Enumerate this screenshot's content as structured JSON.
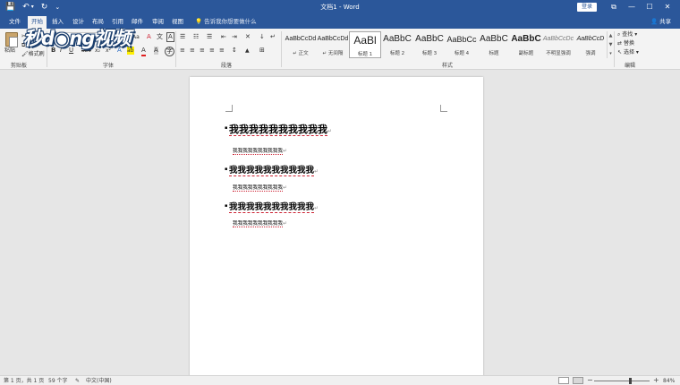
{
  "window": {
    "title": "文档1 - Word",
    "login": "登录",
    "qat": {
      "save": "💾",
      "undo": "↶",
      "undo_arrow": "▾",
      "redo": "↻",
      "customize": "⌄"
    },
    "controls": {
      "restore": "⧉",
      "minimize": "—",
      "maximize": "☐",
      "close": "✕"
    }
  },
  "tabs": [
    {
      "label": "文件",
      "active": false
    },
    {
      "label": "开始",
      "active": true
    },
    {
      "label": "插入",
      "active": false
    },
    {
      "label": "设计",
      "active": false
    },
    {
      "label": "布局",
      "active": false
    },
    {
      "label": "引用",
      "active": false
    },
    {
      "label": "邮件",
      "active": false
    },
    {
      "label": "审阅",
      "active": false
    },
    {
      "label": "视图",
      "active": false
    }
  ],
  "tell_me": "告诉我你想要做什么",
  "share": "共享",
  "share_icon": "person-icon",
  "ribbon": {
    "clipboard": {
      "paste": "粘贴",
      "format_painter": "格式刷",
      "label": "剪贴板"
    },
    "font": {
      "label": "字体",
      "font_size_grow": "A",
      "font_size_shrink": "A",
      "change_case": "Aa",
      "clear_format": "A",
      "phonetic": "文",
      "border_char": "A",
      "bold": "B",
      "italic": "I",
      "underline": "U",
      "strike": "abc",
      "subscript": "x₂",
      "superscript": "x²",
      "text_effect": "A",
      "highlight": "ab",
      "font_color": "A",
      "shading": "A",
      "enclose": "字"
    },
    "paragraph": {
      "label": "段落",
      "bullets": "☰",
      "numbering": "☷",
      "multilevel": "☰",
      "decrease_indent": "⇤",
      "increase_indent": "⇥",
      "chinese_layout": "✕",
      "sort": "↓",
      "show_marks": "↵",
      "align_left": "≡",
      "center": "≡",
      "align_right": "≡",
      "justify": "≡",
      "distribute": "≡",
      "line_spacing": "↕",
      "shading": "▲",
      "borders": "⊞"
    },
    "styles": {
      "label": "样式",
      "items": [
        {
          "sample": "AaBbCcDd",
          "name": "↵ 正文"
        },
        {
          "sample": "AaBbCcDd",
          "name": "↵ 无间隔"
        },
        {
          "sample": "AaBl",
          "name": "标题 1"
        },
        {
          "sample": "AaBbC",
          "name": "标题 2"
        },
        {
          "sample": "AaBbC",
          "name": "标题 3"
        },
        {
          "sample": "AaBbCc",
          "name": "标题 4"
        },
        {
          "sample": "AaBbC",
          "name": "标题"
        },
        {
          "sample": "AaBbC",
          "name": "副标题"
        },
        {
          "sample": "AaBbCcDc",
          "name": "不明显强调"
        },
        {
          "sample": "AaBbCcD",
          "name": "强调"
        }
      ]
    },
    "editing": {
      "label": "编辑",
      "find": "查找",
      "replace": "替换",
      "select": "选择"
    }
  },
  "watermark": "秒d◉ng视频",
  "document": {
    "headings": [
      "我我我我我我我我我我",
      "我我我我我我我我我我",
      "我我我我我我我我我我"
    ],
    "body_lines": [
      "我我我我我我我我我我",
      "我我我我我我我我我我",
      "我我我我我我我我我我"
    ],
    "para_mark": "↵"
  },
  "status": {
    "page": "第 1 页，共 1 页",
    "words": "59 个字",
    "spell_icon": "proofing-icon",
    "language": "中文(中国)",
    "zoom_minus": "−",
    "zoom_plus": "+",
    "zoom": "84%"
  }
}
